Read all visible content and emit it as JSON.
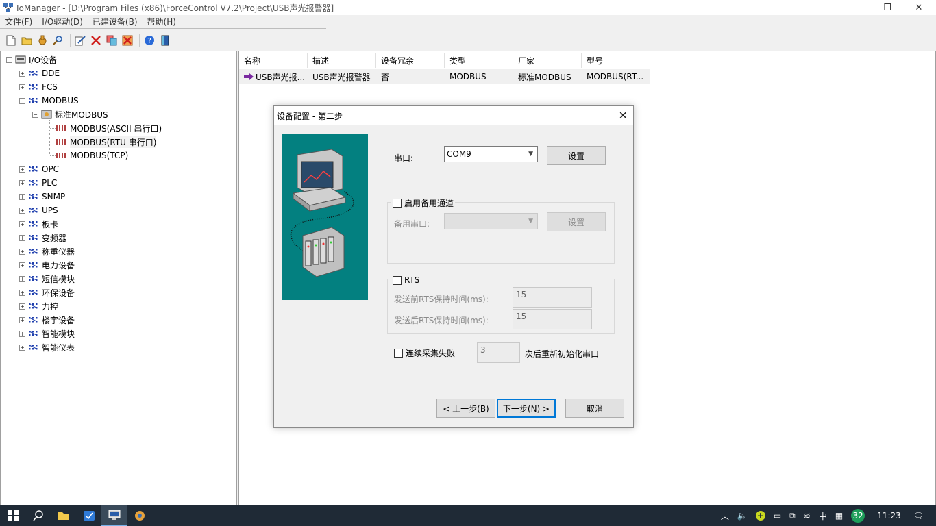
{
  "window": {
    "title": "IoManager - [D:\\Program Files (x86)\\ForceControl V7.2\\Project\\USB声光报警器]"
  },
  "menu": [
    "文件(F)",
    "I/O驱动(D)",
    "已建设备(B)",
    "帮助(H)"
  ],
  "toolbar": {
    "icons": [
      "new-file-icon",
      "open-folder-icon",
      "hand-icon",
      "search-icon",
      "edit-icon",
      "delete-icon",
      "copy-icon",
      "cut-icon",
      "help-icon",
      "book-icon"
    ]
  },
  "tree": {
    "root": "I/O设备",
    "items": [
      "DDE",
      "FCS",
      "MODBUS",
      "OPC",
      "PLC",
      "SNMP",
      "UPS",
      "板卡",
      "变频器",
      "称重仪器",
      "电力设备",
      "短信模块",
      "环保设备",
      "力控",
      "楼宇设备",
      "智能模块",
      "智能仪表"
    ],
    "modbus_child": "标准MODBUS",
    "modbus_leaves": [
      "MODBUS(ASCII 串行口)",
      "MODBUS(RTU 串行口)",
      "MODBUS(TCP)"
    ]
  },
  "list": {
    "headers": [
      "名称",
      "描述",
      "设备冗余",
      "类型",
      "厂家",
      "型号"
    ],
    "rows": [
      [
        "USB声光报...",
        "USB声光报警器",
        "否",
        "MODBUS",
        "标准MODBUS",
        "MODBUS(RT..."
      ]
    ]
  },
  "dialog": {
    "title": "设备配置 - 第二步",
    "port_label": "串口:",
    "port_value": "COM9",
    "settings_button": "设置",
    "backup_checkbox": "启用备用通道",
    "backup_port_label": "备用串口:",
    "backup_settings_button": "设置",
    "rts_checkbox": "RTS",
    "rts_before_label": "发送前RTS保持时间(ms):",
    "rts_before_value": "15",
    "rts_after_label": "发送后RTS保持时间(ms):",
    "rts_after_value": "15",
    "fail_checkbox": "连续采集失败",
    "fail_count": "3",
    "fail_suffix": "次后重新初始化串口",
    "back_button": "< 上一步(B)",
    "next_button": "下一步(N) >",
    "cancel_button": "取消"
  },
  "taskbar": {
    "time": "11:23",
    "ime": "中",
    "badge": "32"
  }
}
